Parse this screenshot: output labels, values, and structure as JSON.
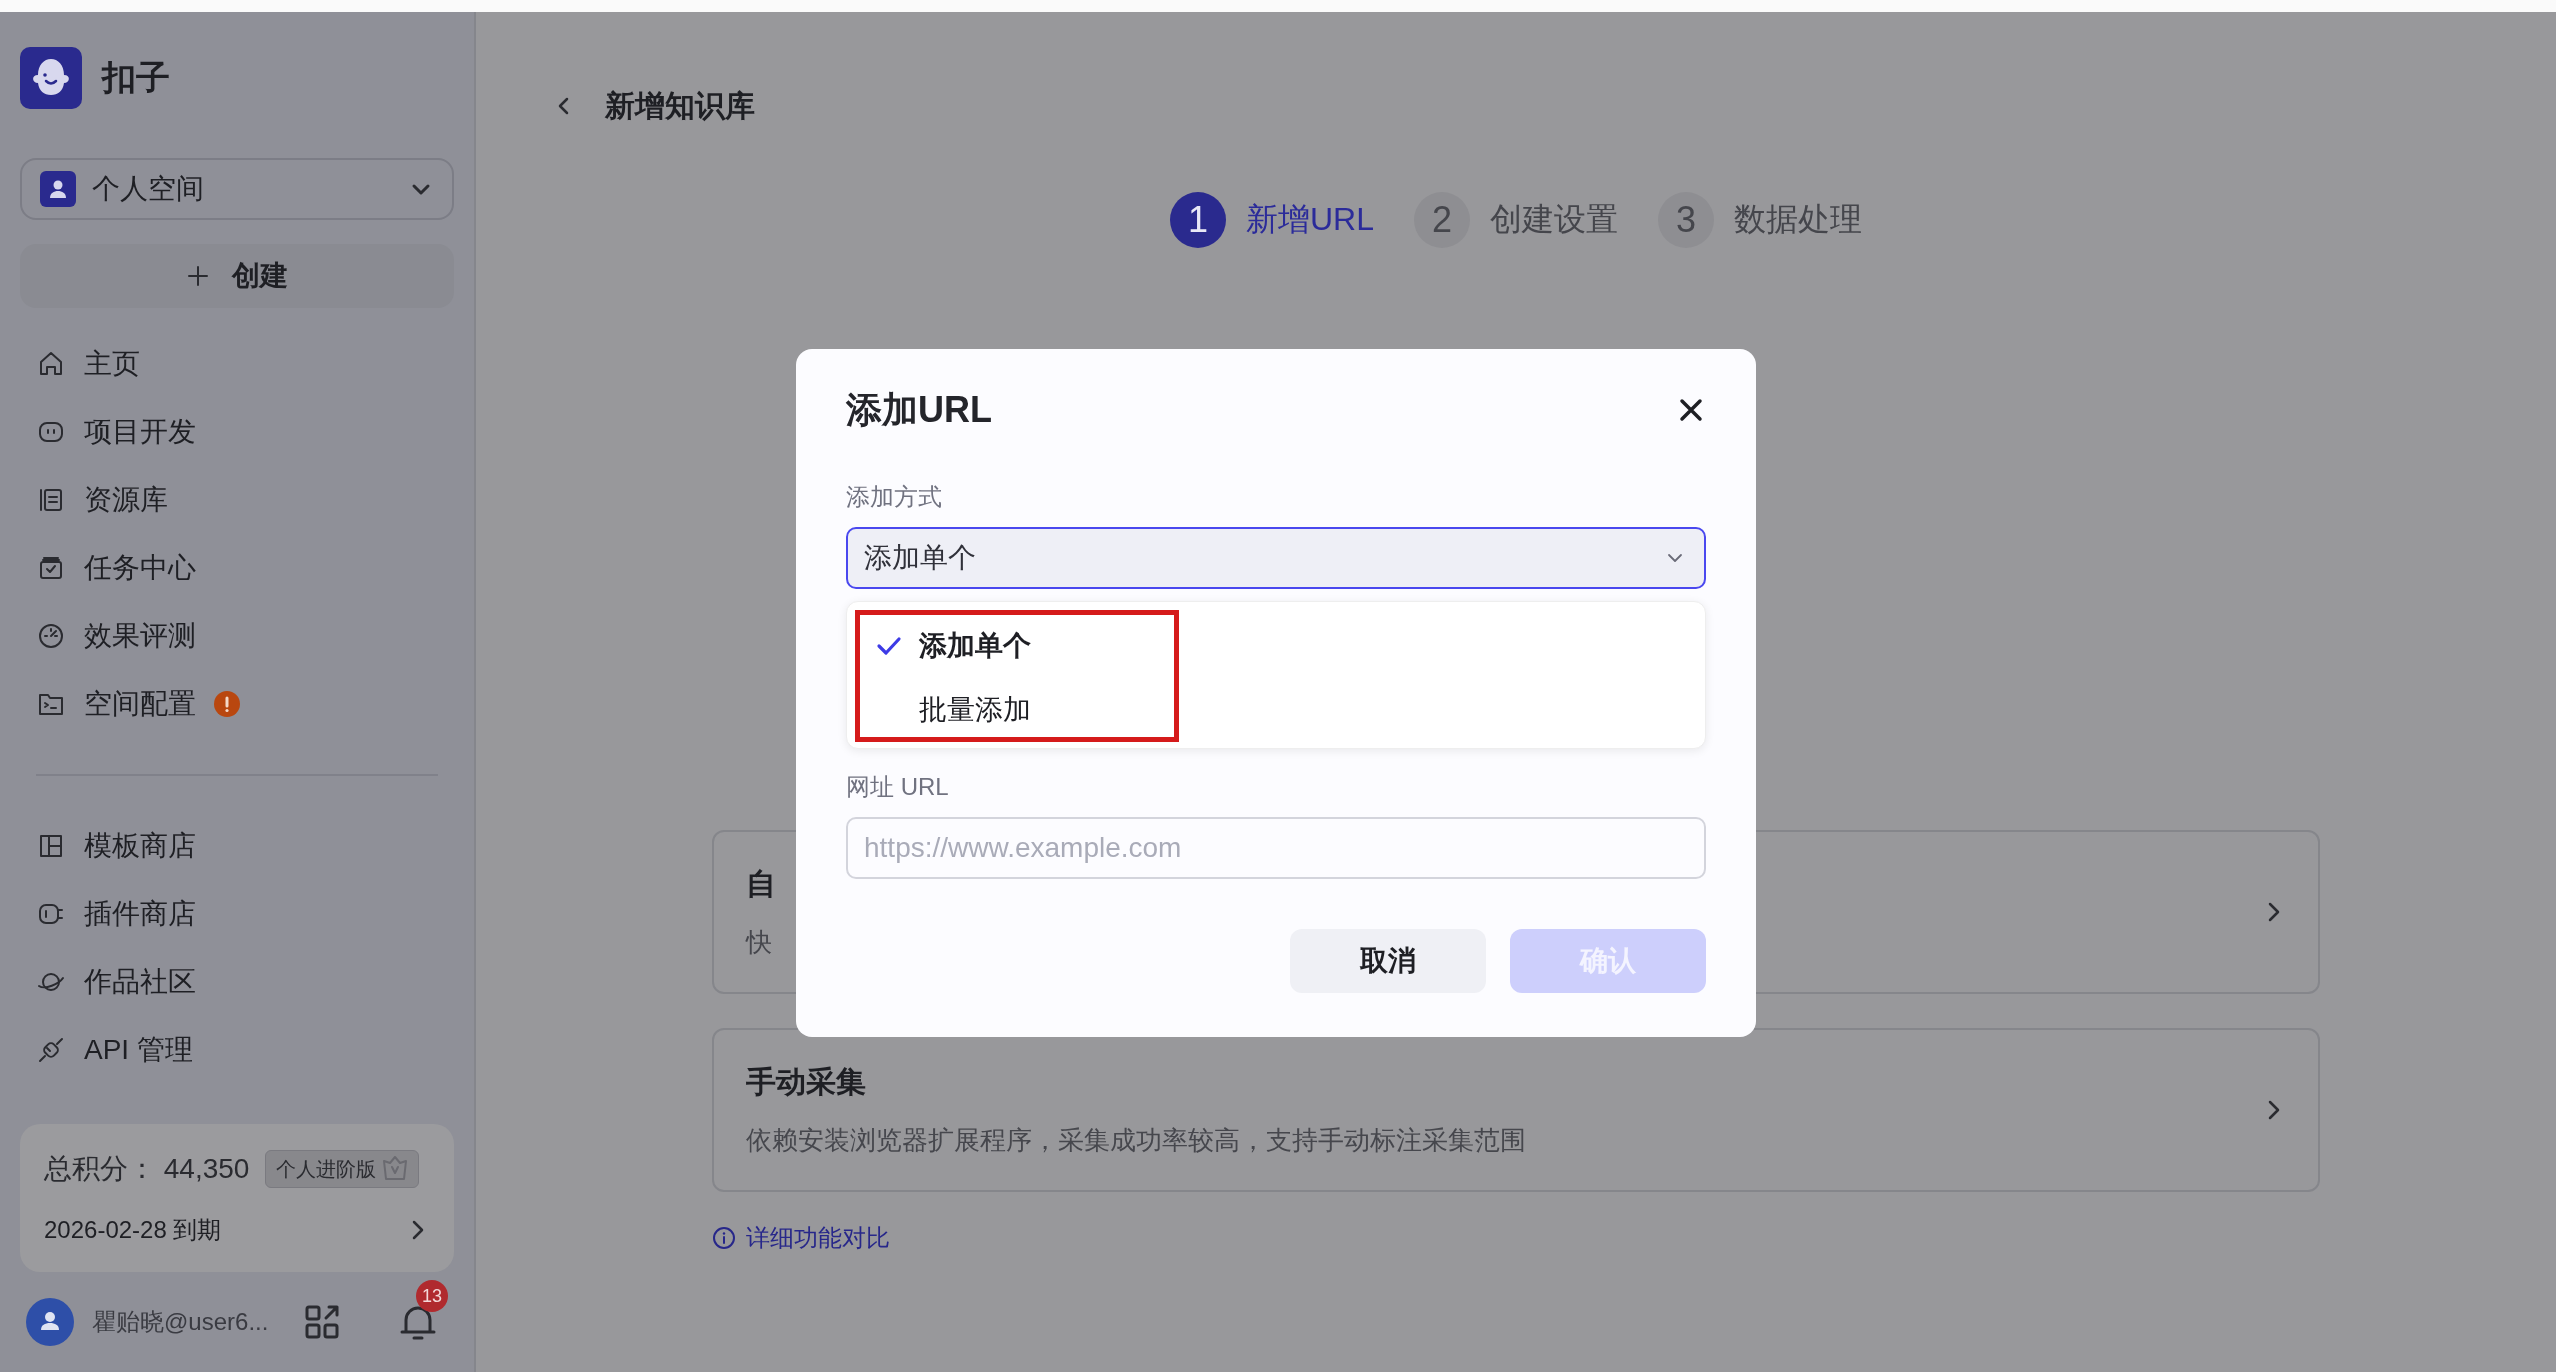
{
  "sidebar": {
    "brand": "扣子",
    "workspace": "个人空间",
    "create_button": "创建",
    "nav_groups": [
      [
        {
          "label": "主页",
          "alert": false
        },
        {
          "label": "项目开发",
          "alert": false
        },
        {
          "label": "资源库",
          "alert": false
        },
        {
          "label": "任务中心",
          "alert": false
        },
        {
          "label": "效果评测",
          "alert": false
        },
        {
          "label": "空间配置",
          "alert": true
        }
      ],
      [
        {
          "label": "模板商店",
          "alert": false
        },
        {
          "label": "插件商店",
          "alert": false
        },
        {
          "label": "作品社区",
          "alert": false
        },
        {
          "label": "API 管理",
          "alert": false
        }
      ]
    ],
    "plan_card": {
      "points_label": "总积分：",
      "points": "44,350",
      "plan_badge": "个人进阶版",
      "expiry": "2026-02-28 到期"
    },
    "user": {
      "name": "瞿贻晓@user6...",
      "notification_count": "13"
    }
  },
  "main": {
    "title": "新增知识库",
    "steps": [
      {
        "number": "1",
        "label": "新增URL",
        "selected": true
      },
      {
        "number": "2",
        "label": "创建设置",
        "selected": false
      },
      {
        "number": "3",
        "label": "数据处理",
        "selected": false
      }
    ],
    "options": [
      {
        "title": "自",
        "description": "快"
      },
      {
        "title": "手动采集",
        "description": "依赖安装浏览器扩展程序，采集成功率较高，支持手动标注采集范围"
      }
    ],
    "compare_link": "详细功能对比"
  },
  "dialog": {
    "title": "添加URL",
    "method_label": "添加方式",
    "method_value": "添加单个",
    "dropdown": {
      "open": true,
      "highlighted": true,
      "options": [
        {
          "label": "添加单个",
          "selected": true
        },
        {
          "label": "批量添加",
          "selected": false
        }
      ]
    },
    "url_label": "网址 URL",
    "url_field": {
      "placeholder": "https://www.example.com"
    },
    "buttons": [
      {
        "label": "取消",
        "kind": "secondary",
        "disabled": false
      },
      {
        "label": "确认",
        "kind": "primary",
        "disabled": true
      }
    ]
  }
}
